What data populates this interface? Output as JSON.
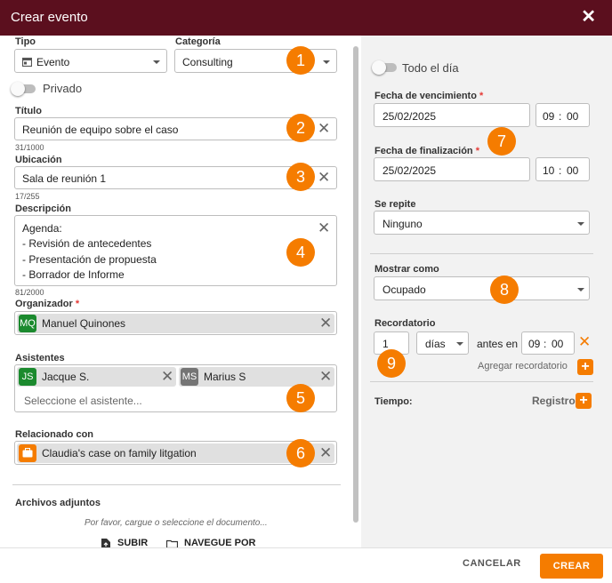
{
  "dialog": {
    "title": "Crear evento",
    "close_icon": "close-icon"
  },
  "form": {
    "tipo": {
      "label": "Tipo",
      "value": "Evento",
      "icon": "calendar-icon"
    },
    "categoria": {
      "label": "Categoría",
      "value": "Consulting"
    },
    "privado": {
      "label": "Privado"
    },
    "titulo": {
      "label": "Título",
      "value": "Reunión de equipo sobre el caso",
      "counter": "31/1000"
    },
    "ubicacion": {
      "label": "Ubicación",
      "value": "Sala de reunión 1",
      "counter": "17/255"
    },
    "descripcion": {
      "label": "Descripción",
      "lines": [
        "Agenda:",
        "- Revisión de antecedentes",
        "- Presentación de propuesta",
        "- Borrador de Informe"
      ],
      "counter": "81/2000"
    },
    "organizador": {
      "label": "Organizador",
      "required": "*",
      "initials": "MQ",
      "name": "Manuel Quinones",
      "color": "#1b8a2e"
    },
    "asistentes": {
      "label": "Asistentes",
      "chips": [
        {
          "initials": "JS",
          "name": "Jacque S.",
          "color": "#1b8a2e"
        },
        {
          "initials": "MS",
          "name": "Marius S",
          "color": "#757575"
        }
      ],
      "placeholder": "Seleccione el asistente..."
    },
    "relacionado": {
      "label": "Relacionado con",
      "value": "Claudia's case on family litgation",
      "icon": "briefcase-icon",
      "color": "#f57c00"
    },
    "archivos": {
      "label": "Archivos adjuntos",
      "hint": "Por favor, cargue o seleccione el documento...",
      "upload": "SUBIR",
      "browse": "NAVEGUE POR"
    }
  },
  "right": {
    "todo_el_dia": "Todo el día",
    "vencimiento": {
      "label": "Fecha de vencimiento",
      "required": "*",
      "date": "25/02/2025",
      "hour": "09",
      "minute": "00"
    },
    "finalizacion": {
      "label": "Fecha de finalización",
      "required": "*",
      "date": "25/02/2025",
      "hour": "10",
      "minute": "00"
    },
    "repite": {
      "label": "Se repite",
      "value": "Ninguno"
    },
    "mostrar": {
      "label": "Mostrar como",
      "value": "Ocupado"
    },
    "recordatorio": {
      "label": "Recordatorio",
      "amount": "1",
      "unit": "días",
      "before": "antes en",
      "hour": "09",
      "minute": "00",
      "add": "Agregar recordatorio"
    },
    "tiempo": {
      "label": "Tiempo:",
      "registro": "Registro"
    }
  },
  "badges": [
    "1",
    "2",
    "3",
    "4",
    "5",
    "6",
    "7",
    "8",
    "9"
  ],
  "footer": {
    "cancel": "CANCELAR",
    "create": "CREAR"
  },
  "colors": {
    "header": "#5b0f1e",
    "accent": "#f57c00",
    "right_panel": "#f2f2f2"
  }
}
